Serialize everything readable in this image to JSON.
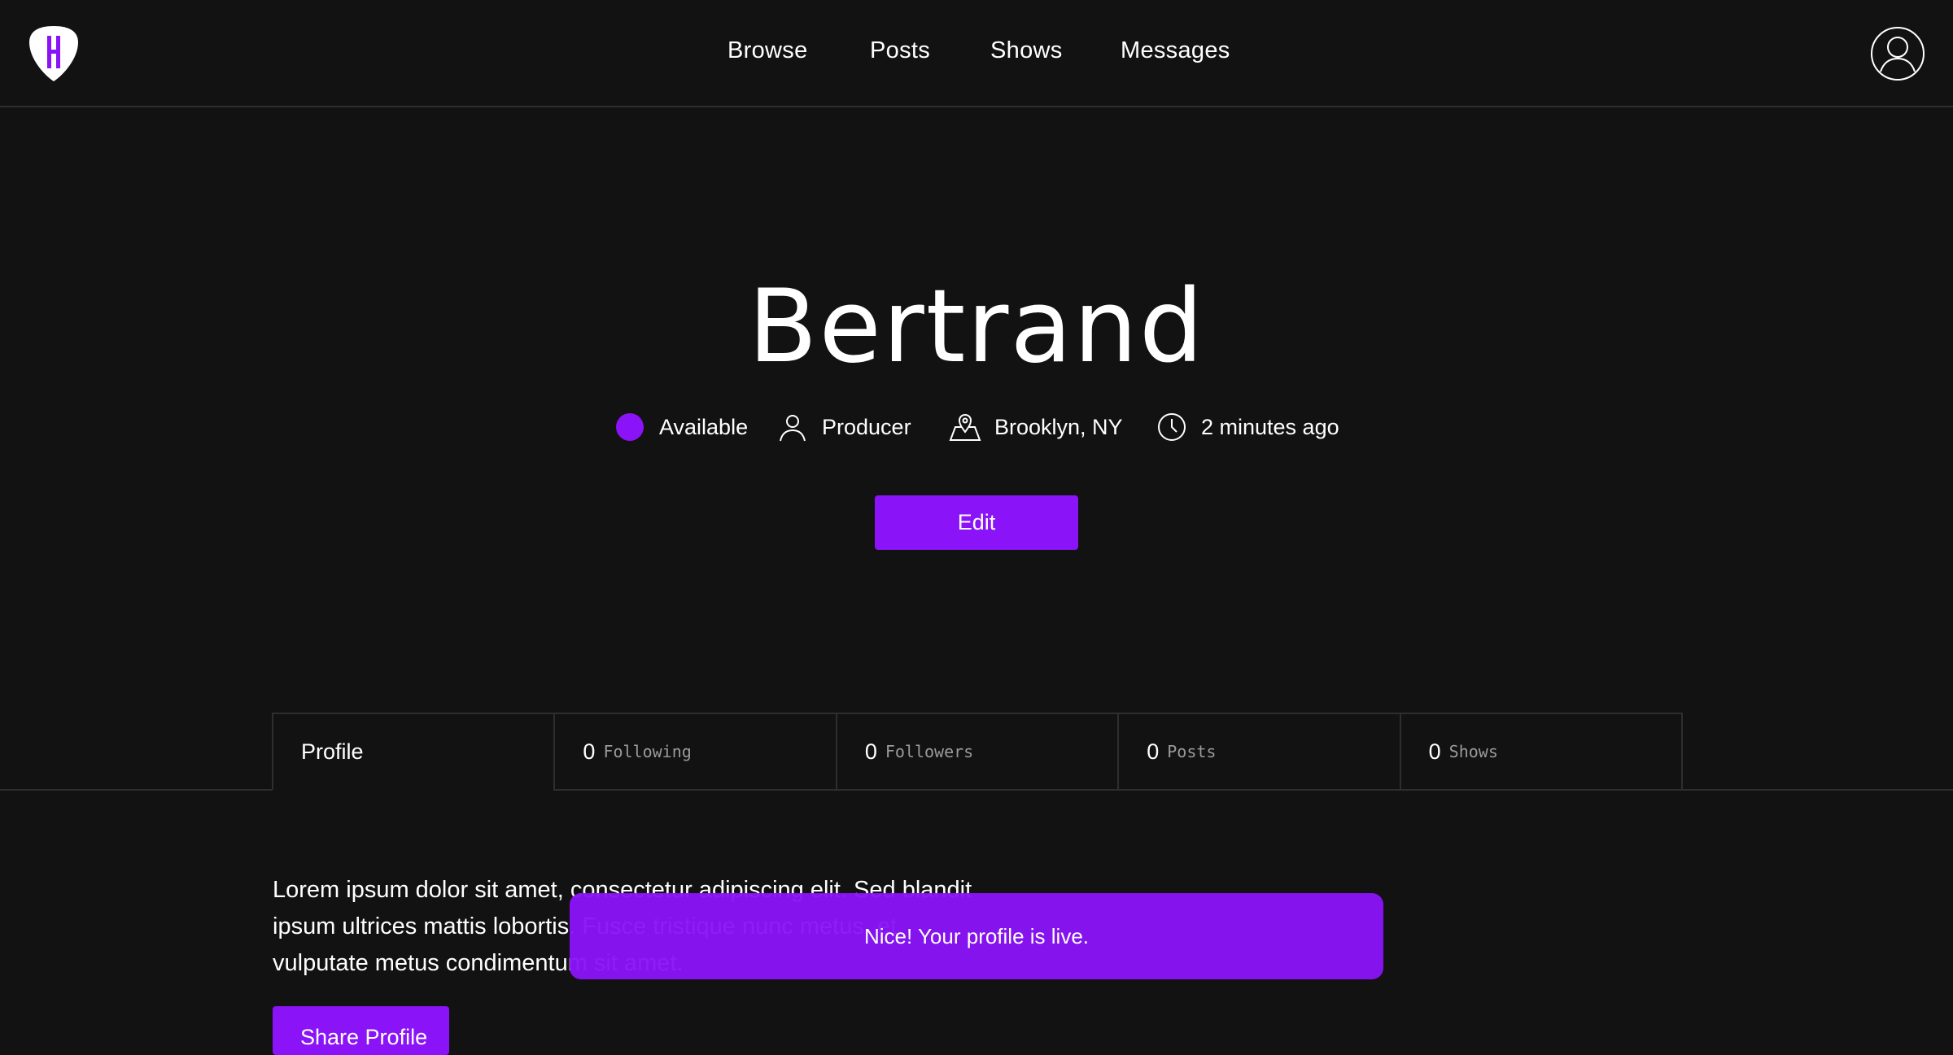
{
  "colors": {
    "accent": "#8a14f7",
    "background": "#121212",
    "border": "#2e2e2e",
    "muted_text": "#9a9a9a"
  },
  "header": {
    "logo_icon": "guitar-pick-logo",
    "nav": [
      {
        "label": "Browse"
      },
      {
        "label": "Posts"
      },
      {
        "label": "Shows"
      },
      {
        "label": "Messages"
      }
    ],
    "avatar_icon": "user-avatar-icon"
  },
  "profile": {
    "name": "Bertrand",
    "status": "Available",
    "role": "Producer",
    "location": "Brooklyn, NY",
    "last_seen": "2 minutes ago",
    "edit_label": "Edit"
  },
  "tabs": {
    "profile_label": "Profile",
    "following": {
      "count": "0",
      "label": "Following"
    },
    "followers": {
      "count": "0",
      "label": "Followers"
    },
    "posts": {
      "count": "0",
      "label": "Posts"
    },
    "shows": {
      "count": "0",
      "label": "Shows"
    }
  },
  "bio": {
    "text": "Lorem ipsum dolor sit amet, consectetur adipiscing elit. Sed blandit ipsum ultrices mattis lobortis. Fusce tristique nunc metus, et vulputate metus condimentum sit amet.",
    "share_label": "Share Profile"
  },
  "toast": {
    "message": "Nice! Your profile is live."
  }
}
